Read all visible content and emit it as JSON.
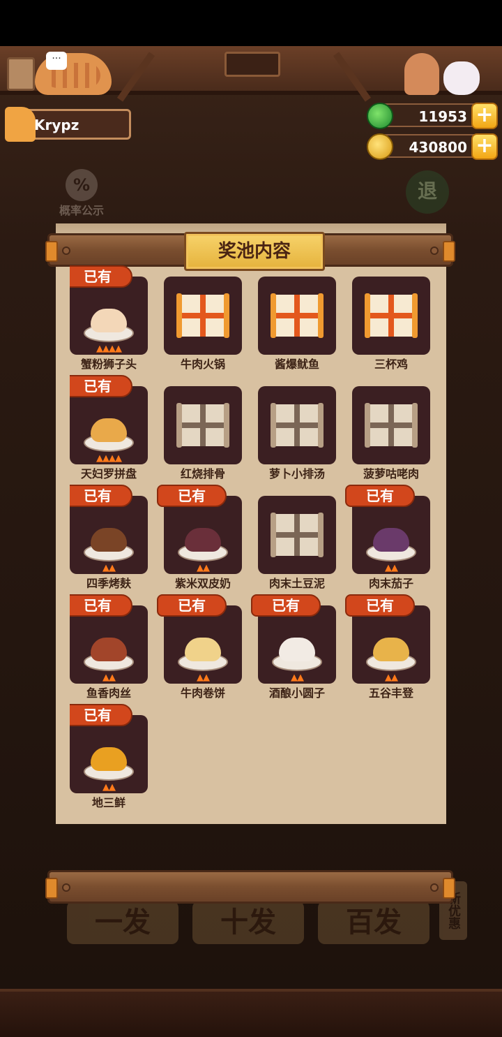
{
  "player": {
    "name": "Krypz"
  },
  "currencies": [
    {
      "icon": "jade-icon",
      "amount": "11953",
      "add_label": "+"
    },
    {
      "icon": "coin-icon",
      "amount": "430800",
      "add_label": "+"
    }
  ],
  "background": {
    "probability_label": "概率公示",
    "probability_icon_text": "%",
    "exit_label": "退",
    "draw_buttons": [
      "一发",
      "十发",
      "百发"
    ],
    "side_tag": "新优惠"
  },
  "panel": {
    "title": "奖池内容",
    "owned_label": "已有",
    "items": [
      {
        "name": "蟹粉狮子头",
        "owned": true,
        "stars": 4,
        "food_color": "#f3d7b8"
      },
      {
        "name": "牛肉火锅",
        "owned": false,
        "locked_style": "gold"
      },
      {
        "name": "酱爆鱿鱼",
        "owned": false,
        "locked_style": "gold"
      },
      {
        "name": "三杯鸡",
        "owned": false,
        "locked_style": "gold"
      },
      {
        "name": "天妇罗拼盘",
        "owned": true,
        "stars": 4,
        "food_color": "#e9a94a"
      },
      {
        "name": "红烧排骨",
        "owned": false,
        "locked_style": "plain"
      },
      {
        "name": "萝卜小排汤",
        "owned": false,
        "locked_style": "plain"
      },
      {
        "name": "菠萝咕咾肉",
        "owned": false,
        "locked_style": "plain"
      },
      {
        "name": "四季烤麸",
        "owned": true,
        "stars": 2,
        "food_color": "#7a4426"
      },
      {
        "name": "紫米双皮奶",
        "owned": true,
        "stars": 2,
        "food_color": "#6a2f3a"
      },
      {
        "name": "肉末土豆泥",
        "owned": false,
        "locked_style": "plain"
      },
      {
        "name": "肉末茄子",
        "owned": true,
        "stars": 2,
        "food_color": "#6a3a6a"
      },
      {
        "name": "鱼香肉丝",
        "owned": true,
        "stars": 2,
        "food_color": "#a2452a"
      },
      {
        "name": "牛肉卷饼",
        "owned": true,
        "stars": 2,
        "food_color": "#f0d28a"
      },
      {
        "name": "酒酿小圆子",
        "owned": true,
        "stars": 2,
        "food_color": "#f2ebe4"
      },
      {
        "name": "五谷丰登",
        "owned": true,
        "stars": 2,
        "food_color": "#e8b34a"
      },
      {
        "name": "地三鲜",
        "owned": true,
        "stars": 2,
        "food_color": "#e9a021"
      }
    ]
  }
}
